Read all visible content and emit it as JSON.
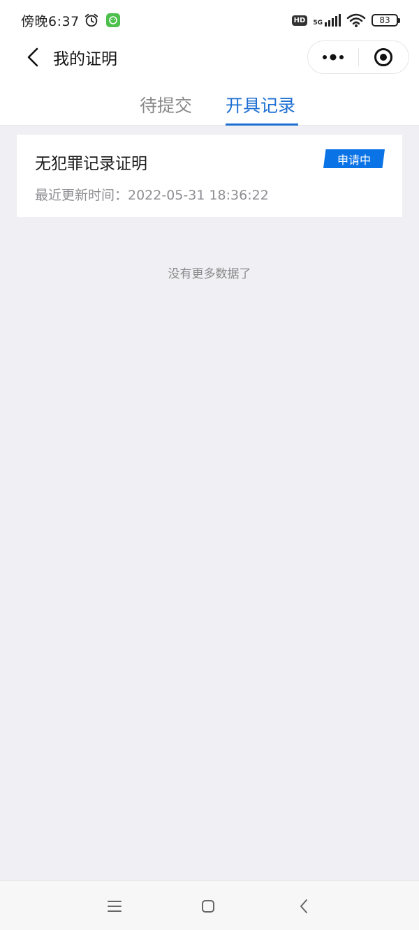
{
  "status_bar": {
    "time": "傍晚6:37",
    "hd": "HD",
    "network": "5G",
    "battery": "83"
  },
  "header": {
    "title": "我的证明"
  },
  "tabs": [
    {
      "label": "待提交",
      "active": false
    },
    {
      "label": "开具记录",
      "active": true
    }
  ],
  "records": [
    {
      "title": "无犯罪记录证明",
      "status": "申请中",
      "updated": "最近更新时间：2022-05-31 18:36:22"
    }
  ],
  "list_end_text": "没有更多数据了",
  "colors": {
    "accent": "#1e6fd2",
    "badge": "#0a73e6",
    "background": "#efeff4"
  },
  "icons": [
    "alarm-icon",
    "app-badge-icon",
    "signal-icon",
    "wifi-icon",
    "back-icon",
    "more-icon",
    "close-target-icon",
    "menu-icon",
    "home-icon",
    "nav-back-icon"
  ]
}
